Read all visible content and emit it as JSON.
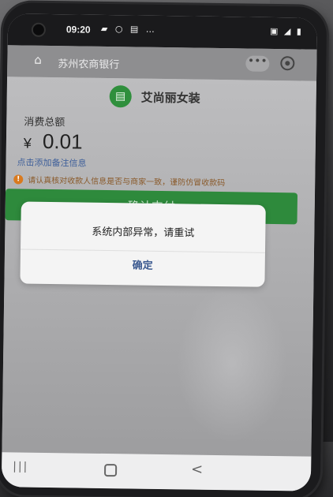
{
  "status_bar": {
    "time": "09:20",
    "left_icons": "▰ ○ ▤ …",
    "right_icons": "▣ ◢ ▮"
  },
  "title_bar": {
    "title": "苏州农商银行",
    "more_label": "•••"
  },
  "merchant": {
    "name": "艾尚丽女装",
    "icon": "store-icon",
    "icon_color": "#2f8f3c"
  },
  "payment": {
    "amount_label": "消费总额",
    "currency": "¥",
    "amount": "0.01",
    "add_note": "点击添加备注信息",
    "warning": "请认真核对收款人信息是否与商家一致，谨防仿冒收款码",
    "pay_button": "确认支付",
    "accent_color": "#2e8a3c"
  },
  "dialog": {
    "message": "系统内部异常，请重试",
    "confirm": "确定"
  },
  "nav": {
    "recent": "|||",
    "back": "<"
  }
}
